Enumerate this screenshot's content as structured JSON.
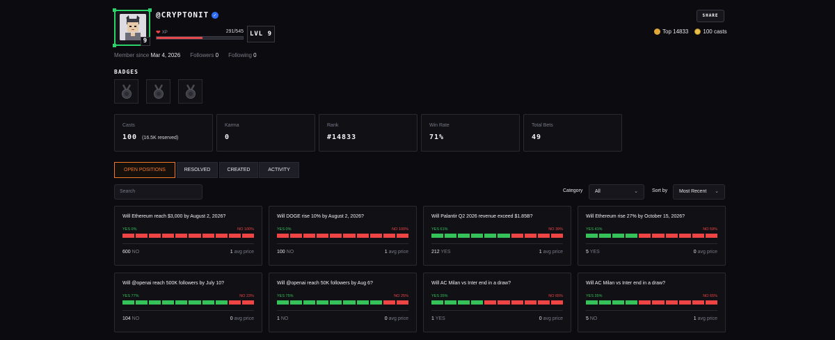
{
  "profile": {
    "username": "@CRYPTONIT",
    "avatar_level": "9",
    "xp_label": "XP",
    "xp_value": "291/545",
    "xp_progress": 0.534,
    "level": "LVL 9",
    "member_since_label": "Member since",
    "member_since": "Mar 4, 2026",
    "followers_label": "Followers",
    "followers": "0",
    "following_label": "Following",
    "following": "0",
    "share_label": "SHARE",
    "rank_text": "Top 14833",
    "casts_text": "100 casts"
  },
  "badges": {
    "title": "BADGES",
    "items": [
      "medal-icon",
      "medal-icon",
      "medal-icon"
    ]
  },
  "stats": [
    {
      "label": "Casts",
      "value": "100",
      "extra": "(16.5K reserved)"
    },
    {
      "label": "Karma",
      "value": "0",
      "extra": ""
    },
    {
      "label": "Rank",
      "value": "#14833",
      "extra": ""
    },
    {
      "label": "Win Rate",
      "value": "71%",
      "extra": ""
    },
    {
      "label": "Total Bets",
      "value": "49",
      "extra": ""
    }
  ],
  "tabs": [
    "OPEN POSITIONS",
    "RESOLVED",
    "CREATED",
    "ACTIVITY"
  ],
  "filters": {
    "search_placeholder": "Search",
    "category_label": "Category",
    "category_value": "All",
    "sort_label": "Sort by",
    "sort_value": "Most Recent"
  },
  "colors": {
    "yes": "#34c259",
    "no": "#ef4444",
    "accent": "#f07a2a",
    "xp": "#e5484d"
  },
  "markets": [
    {
      "question": "Will Ethereum reach $3,000 by August 2, 2026?",
      "yes": "YES 0%",
      "no": "NO 100%",
      "yes_pct": 0,
      "shares": "600",
      "side": "NO",
      "avg": "1",
      "avg_label": "avg price"
    },
    {
      "question": "Will DOGE rise 10% by August 2, 2026?",
      "yes": "YES 0%",
      "no": "NO 100%",
      "yes_pct": 0,
      "shares": "100",
      "side": "NO",
      "avg": "1",
      "avg_label": "avg price"
    },
    {
      "question": "Will Palantir Q2 2026 revenue exceed $1.85B?",
      "yes": "YES 61%",
      "no": "NO 39%",
      "yes_pct": 61,
      "shares": "212",
      "side": "YES",
      "avg": "1",
      "avg_label": "avg price"
    },
    {
      "question": "Will Ethereum rise 27% by October 15, 2026?",
      "yes": "YES 41%",
      "no": "NO 59%",
      "yes_pct": 41,
      "shares": "5",
      "side": "YES",
      "avg": "0",
      "avg_label": "avg price"
    },
    {
      "question": "Will @openai reach 500K followers by July 10?",
      "yes": "YES 77%",
      "no": "NO 23%",
      "yes_pct": 77,
      "shares": "104",
      "side": "NO",
      "avg": "0",
      "avg_label": "avg price"
    },
    {
      "question": "Will @openai reach 50K followers by Aug 6?",
      "yes": "YES 75%",
      "no": "NO 25%",
      "yes_pct": 75,
      "shares": "1",
      "side": "NO",
      "avg": "0",
      "avg_label": "avg price"
    },
    {
      "question": "Will AC Milan vs Inter end in a draw?",
      "yes": "YES 35%",
      "no": "NO 65%",
      "yes_pct": 35,
      "shares": "1",
      "side": "YES",
      "avg": "0",
      "avg_label": "avg price"
    },
    {
      "question": "Will AC Milan vs Inter end in a draw?",
      "yes": "YES 35%",
      "no": "NO 65%",
      "yes_pct": 35,
      "shares": "5",
      "side": "NO",
      "avg": "1",
      "avg_label": "avg price"
    }
  ]
}
